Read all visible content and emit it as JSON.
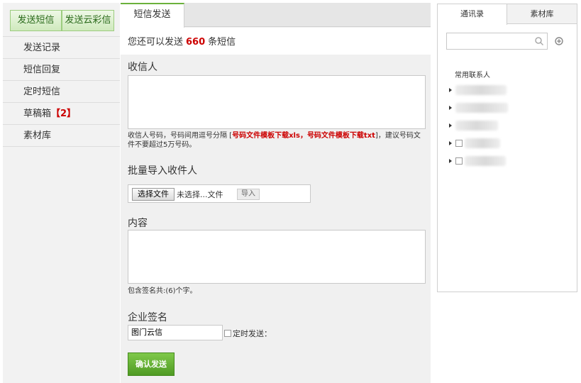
{
  "sidebar": {
    "top_buttons": [
      "发送短信",
      "发送云彩信"
    ],
    "items": [
      {
        "label": "发送记录"
      },
      {
        "label": "短信回复"
      },
      {
        "label": "定时短信"
      },
      {
        "label": "草稿箱",
        "badge": "【2】"
      },
      {
        "label": "素材库"
      }
    ]
  },
  "main": {
    "tab": "短信发送",
    "quota": {
      "prefix": "您还可以发送",
      "count": "660",
      "suffix": "条短信"
    },
    "recipients": {
      "label": "收信人",
      "hint_pre": "收信人号码，号码间用逗号分隔 [",
      "hint_link1": "号码文件模板下载xls",
      "hint_sep": "，",
      "hint_link2": "号码文件模板下载txt",
      "hint_post": "]，建议号码文件不要超过5万号码。"
    },
    "import": {
      "label": "批量导入收件人",
      "choose_file": "选择文件",
      "file_name": "未选择...文件",
      "import_button": "导入"
    },
    "content": {
      "label": "内容",
      "hint": "包含签名共:(6)个字。"
    },
    "signature": {
      "label": "企业签名",
      "value": "图门云信",
      "timer_label": "定时发送："
    },
    "submit": "确认发送"
  },
  "right_panel": {
    "tabs": [
      "通讯录",
      "素材库"
    ],
    "search_icon": "search-icon",
    "add_icon": "plus-circle-icon",
    "group_title": "常用联系人",
    "contacts_count": 5
  },
  "colors": {
    "accent_green": "#6bb13c",
    "button_green": "#5aa52c",
    "highlight_red": "#cc0000"
  }
}
